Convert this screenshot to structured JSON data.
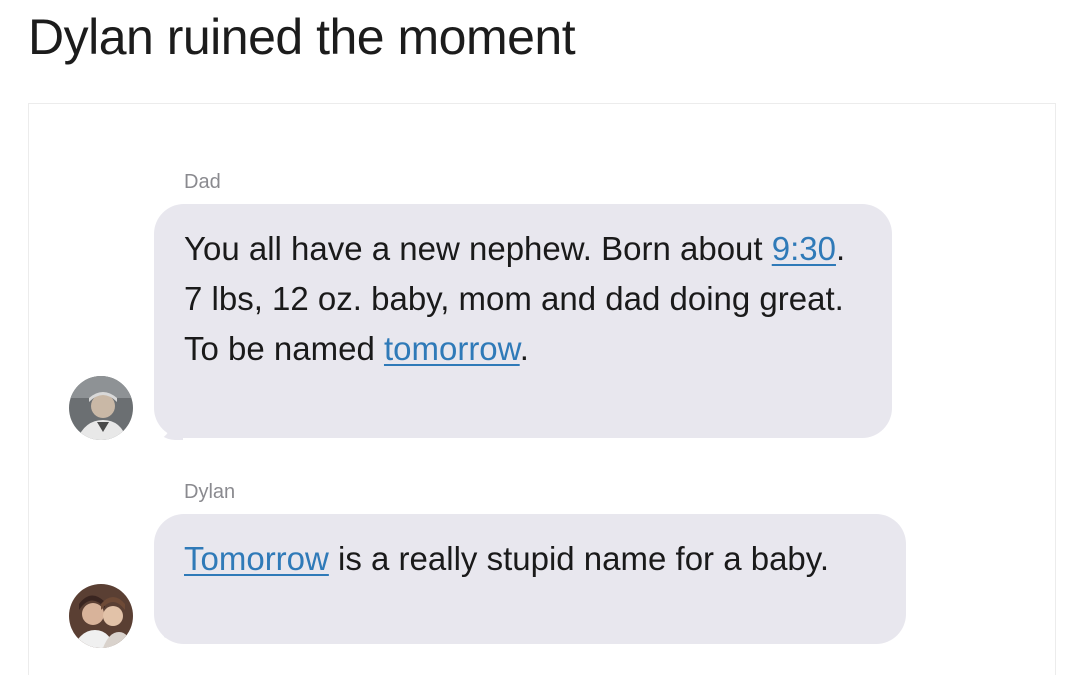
{
  "post": {
    "title": "Dylan ruined the moment"
  },
  "conversation": {
    "messages": [
      {
        "sender": "Dad",
        "avatar_icon": "person-photo-avatar-icon",
        "parts": [
          "You all have a new nephew. Born about ",
          "9:30",
          ". 7 lbs, 12 oz. baby, mom and dad doing great. To be named ",
          "tomorrow",
          "."
        ]
      },
      {
        "sender": "Dylan",
        "avatar_icon": "person-photo-avatar-icon",
        "parts": [
          "Tomorrow",
          " is a really stupid name for a baby."
        ]
      }
    ]
  },
  "colors": {
    "bubble": "#e8e7ee",
    "link": "#2f7ab8",
    "sender_label": "#8a8a8f"
  }
}
